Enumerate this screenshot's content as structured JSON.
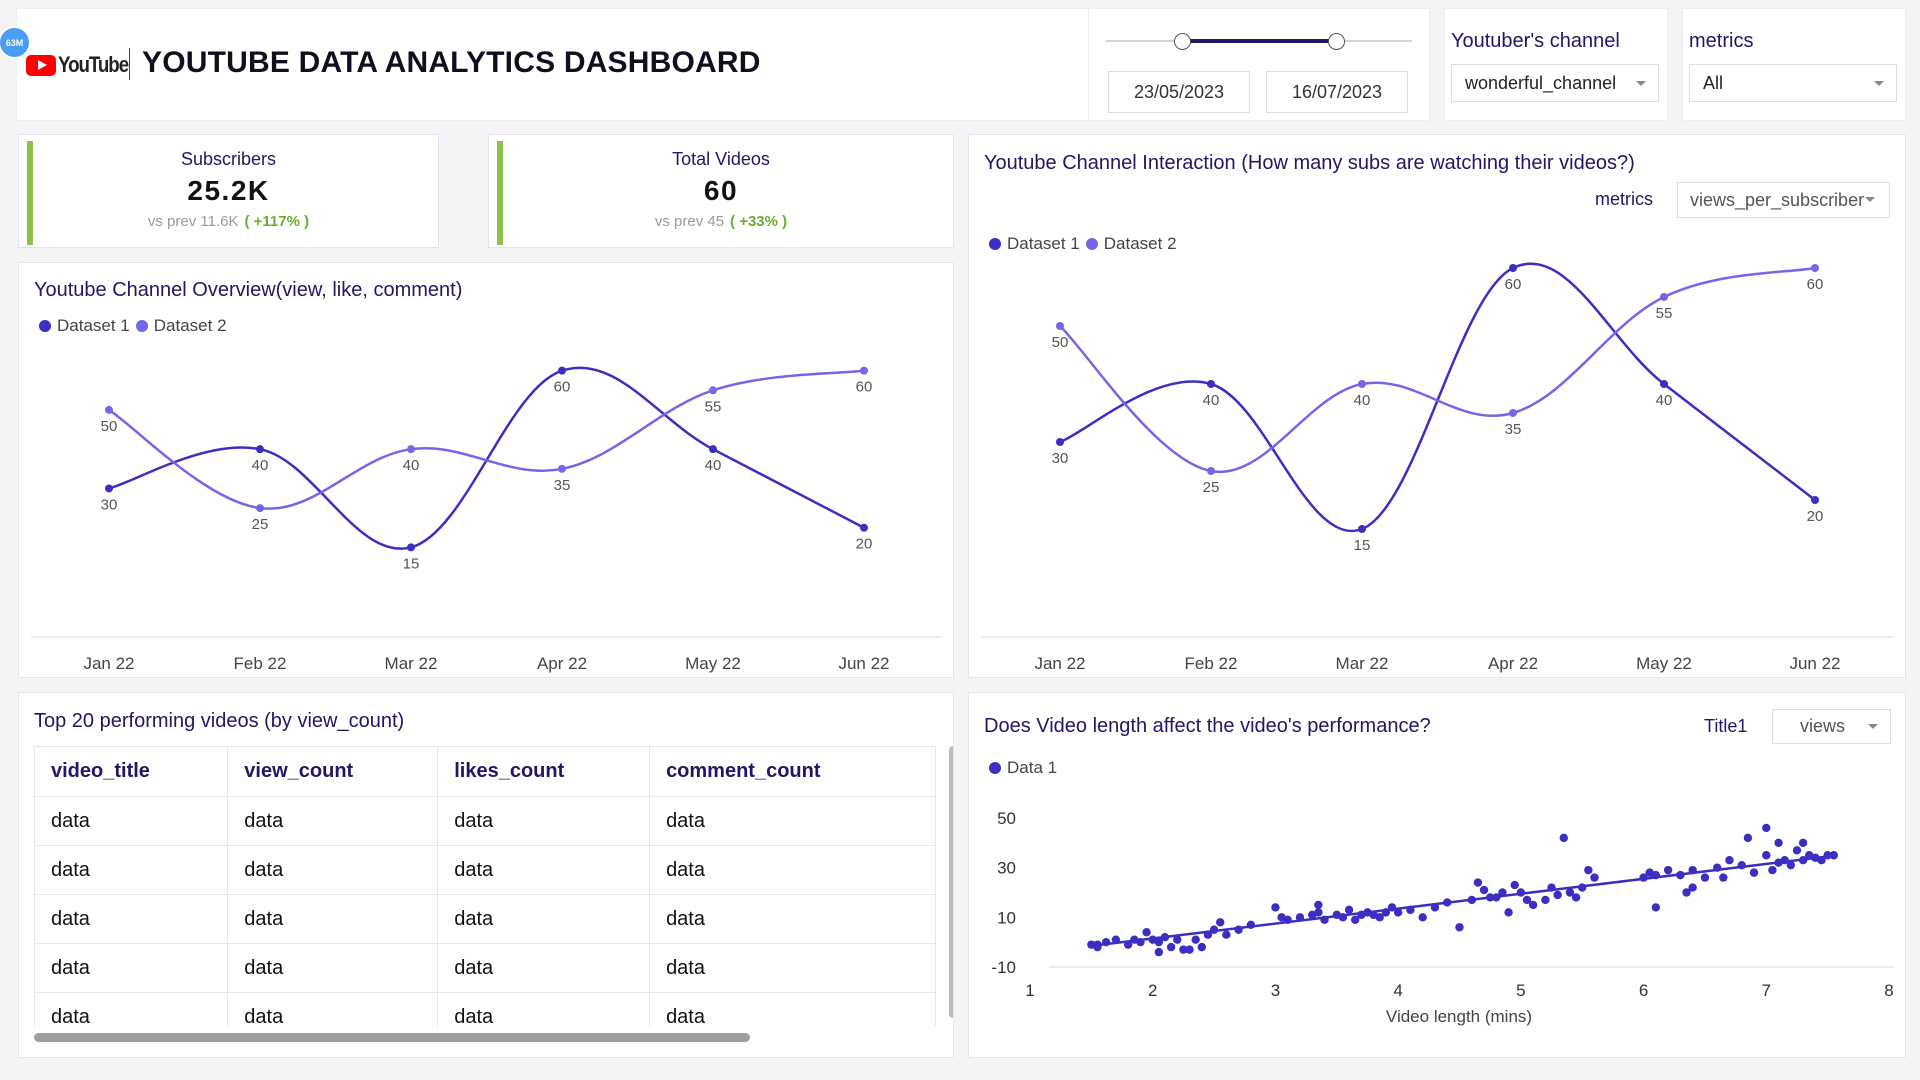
{
  "header": {
    "badge": "63M",
    "brand": "YouTube",
    "title": "YOUTUBE DATA ANALYTICS DASHBOARD"
  },
  "date_range": {
    "start": "23/05/2023",
    "end": "16/07/2023"
  },
  "channel_filter": {
    "label": "Youtuber's channel",
    "value": "wonderful_channel"
  },
  "metrics_filter": {
    "label": "metrics",
    "value": "All"
  },
  "kpis": [
    {
      "label": "Subscribers",
      "value": "25.2K",
      "prev": "vs prev 11.6K",
      "change": "( +117% )"
    },
    {
      "label": "Total Videos",
      "value": "60",
      "prev": "vs prev 45",
      "change": "( +33% )"
    }
  ],
  "overview": {
    "title": "Youtube Channel Overview(view, like, comment)",
    "chart_data": {
      "type": "line",
      "categories": [
        "Jan 22",
        "Feb 22",
        "Mar 22",
        "Apr 22",
        "May 22",
        "Jun 22"
      ],
      "series": [
        {
          "name": "Dataset 1",
          "color": "#3a2fc0",
          "values": [
            30,
            40,
            15,
            60,
            40,
            20
          ]
        },
        {
          "name": "Dataset 2",
          "color": "#7367e8",
          "values": [
            50,
            25,
            40,
            35,
            55,
            60
          ]
        }
      ],
      "ylim": [
        10,
        65
      ]
    }
  },
  "interaction": {
    "title": "Youtube Channel Interaction (How many subs are watching their videos?)",
    "metric_label": "metrics",
    "metric_value": "views_per_subscriber",
    "chart_data": {
      "type": "line",
      "categories": [
        "Jan 22",
        "Feb 22",
        "Mar 22",
        "Apr 22",
        "May 22",
        "Jun 22"
      ],
      "series": [
        {
          "name": "Dataset 1",
          "color": "#3a2fc0",
          "values": [
            30,
            40,
            15,
            60,
            40,
            20
          ]
        },
        {
          "name": "Dataset 2",
          "color": "#7367e8",
          "values": [
            50,
            25,
            40,
            35,
            55,
            60
          ]
        }
      ],
      "ylim": [
        10,
        65
      ]
    }
  },
  "top_videos": {
    "title": "Top 20 performing videos (by view_count)",
    "columns": [
      "video_title",
      "view_count",
      "likes_count",
      "comment_count"
    ],
    "rows": [
      [
        "data",
        "data",
        "data",
        "data"
      ],
      [
        "data",
        "data",
        "data",
        "data"
      ],
      [
        "data",
        "data",
        "data",
        "data"
      ],
      [
        "data",
        "data",
        "data",
        "data"
      ],
      [
        "data",
        "data",
        "data",
        "data"
      ]
    ]
  },
  "length_perf": {
    "title": "Does Video length affect the video's performance?",
    "select_label": "Title1",
    "select_value": "views",
    "chart_data": {
      "type": "scatter",
      "series": [
        {
          "name": "Data 1",
          "color": "#3a2fc0",
          "points": [
            [
              1.5,
              -1
            ],
            [
              1.55,
              -2
            ],
            [
              1.62,
              0
            ],
            [
              1.7,
              1
            ],
            [
              1.8,
              -1
            ],
            [
              1.85,
              1
            ],
            [
              1.9,
              0
            ],
            [
              1.95,
              4
            ],
            [
              2.0,
              1
            ],
            [
              2.05,
              0
            ],
            [
              2.1,
              2
            ],
            [
              2.15,
              -2
            ],
            [
              2.2,
              1
            ],
            [
              2.25,
              -3
            ],
            [
              2.3,
              -3
            ],
            [
              2.35,
              1
            ],
            [
              2.4,
              -2
            ],
            [
              2.45,
              3
            ],
            [
              2.5,
              5
            ],
            [
              2.55,
              8
            ],
            [
              2.6,
              3
            ],
            [
              2.7,
              5
            ],
            [
              2.8,
              7
            ],
            [
              3.0,
              14
            ],
            [
              3.05,
              10
            ],
            [
              3.1,
              9
            ],
            [
              3.2,
              10
            ],
            [
              3.3,
              11
            ],
            [
              3.35,
              12
            ],
            [
              3.4,
              9
            ],
            [
              3.5,
              11
            ],
            [
              3.55,
              10
            ],
            [
              3.6,
              13
            ],
            [
              3.65,
              9
            ],
            [
              3.7,
              11
            ],
            [
              3.75,
              12
            ],
            [
              3.8,
              11
            ],
            [
              3.85,
              10
            ],
            [
              3.9,
              12
            ],
            [
              3.95,
              14
            ],
            [
              4.0,
              12
            ],
            [
              4.1,
              13
            ],
            [
              4.2,
              10
            ],
            [
              4.3,
              14
            ],
            [
              4.4,
              16
            ],
            [
              4.5,
              6
            ],
            [
              4.6,
              17
            ],
            [
              4.65,
              24
            ],
            [
              4.7,
              21
            ],
            [
              4.75,
              18
            ],
            [
              4.8,
              18
            ],
            [
              4.85,
              20
            ],
            [
              4.9,
              12
            ],
            [
              4.95,
              23
            ],
            [
              5.0,
              20
            ],
            [
              5.05,
              17
            ],
            [
              5.1,
              15
            ],
            [
              5.2,
              17
            ],
            [
              5.25,
              22
            ],
            [
              5.3,
              19
            ],
            [
              5.35,
              42
            ],
            [
              5.4,
              20
            ],
            [
              5.45,
              18
            ],
            [
              5.5,
              22
            ],
            [
              5.55,
              29
            ],
            [
              5.6,
              26
            ],
            [
              6.0,
              26
            ],
            [
              6.05,
              28
            ],
            [
              6.1,
              27
            ],
            [
              6.2,
              29
            ],
            [
              6.3,
              27
            ],
            [
              6.35,
              20
            ],
            [
              6.4,
              29
            ],
            [
              6.5,
              26
            ],
            [
              6.6,
              30
            ],
            [
              6.7,
              33
            ],
            [
              6.8,
              31
            ],
            [
              6.9,
              28
            ],
            [
              7.0,
              35
            ],
            [
              7.05,
              29
            ],
            [
              7.1,
              32
            ],
            [
              7.15,
              33
            ],
            [
              7.2,
              31
            ],
            [
              7.25,
              37
            ],
            [
              7.3,
              33
            ],
            [
              7.35,
              35
            ],
            [
              7.4,
              34
            ],
            [
              7.45,
              33
            ],
            [
              7.5,
              35
            ],
            [
              7.55,
              35
            ],
            [
              6.65,
              26
            ],
            [
              7.0,
              46
            ],
            [
              6.4,
              22
            ],
            [
              6.1,
              14
            ],
            [
              6.85,
              42
            ],
            [
              7.3,
              40
            ],
            [
              7.1,
              40
            ],
            [
              3.35,
              15
            ],
            [
              2.05,
              -4
            ],
            [
              1.55,
              -1
            ]
          ],
          "trend": [
            [
              1.5,
              -1.5
            ],
            [
              7.5,
              34.5
            ]
          ]
        }
      ],
      "xlim": [
        1,
        8
      ],
      "ylim": [
        -10,
        50
      ],
      "x_ticks": [
        1,
        2,
        3,
        4,
        5,
        6,
        7,
        8
      ],
      "y_ticks": [
        -10,
        10,
        30,
        50
      ],
      "xlabel": "Video length (mins)"
    }
  }
}
